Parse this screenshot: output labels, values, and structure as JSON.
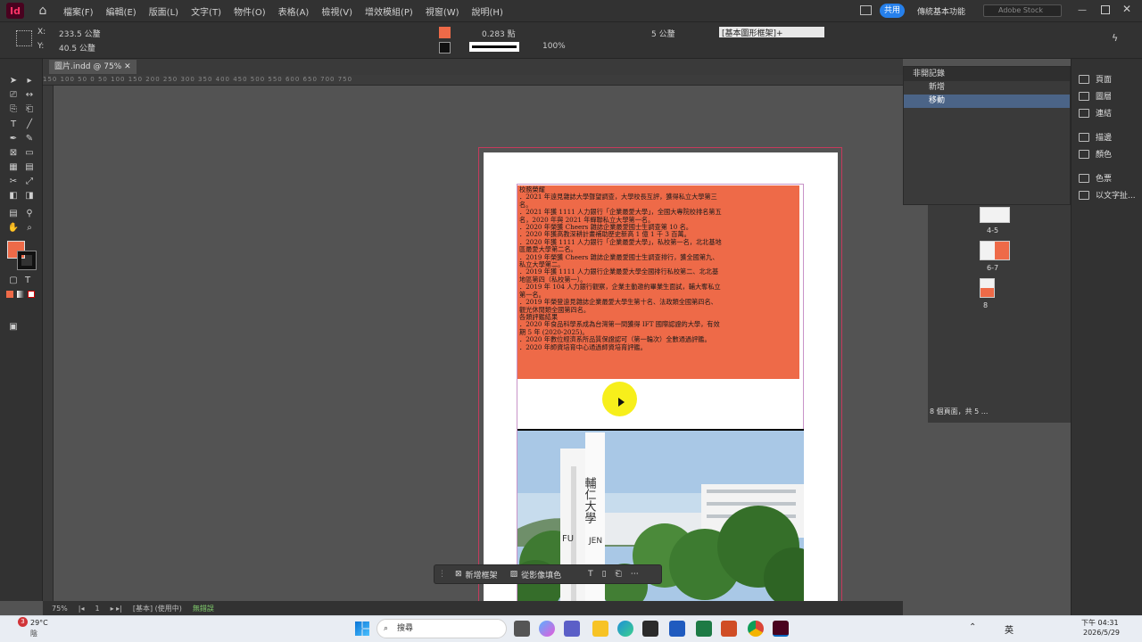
{
  "app": {
    "logo": "Id",
    "share_label": "共用",
    "workspace": "傳統基本功能",
    "search_placeholder": "Adobe Stock"
  },
  "menu": [
    "檔案(F)",
    "編輯(E)",
    "版面(L)",
    "文字(T)",
    "物件(O)",
    "表格(A)",
    "檢視(V)",
    "增效模組(P)",
    "視窗(W)",
    "說明(H)"
  ],
  "control": {
    "x_label": "X:",
    "x_value": "233.5 公釐",
    "y_label": "Y:",
    "y_value": "40.5 公釐",
    "stroke_weight": "0.283 點",
    "percent": "100%",
    "spacing": "5 公釐",
    "frame_style": "[基本圖形框架]+"
  },
  "doc_tab": "圖片.indd @ 75%",
  "ruler_ticks": "150 100 50 0 50 100 150 200 250 300 350 400 450 500 550 600 650 700 750",
  "status": {
    "zoom": "75%",
    "page": "1",
    "style": "[基本] (使用中)",
    "preflight": "無錯誤"
  },
  "document": {
    "lines": [
      "校務榮耀",
      "．2021 年遠見雜誌大學聲望調查，大學校長互評，獲得私立大學第三",
      "名。",
      "．2021 年獲 1111 人力銀行「企業最愛大學」，全國大專院校排名第五",
      "名，2020 年與 2021 年蟬聯私立大學第一名。",
      "．2020 年榮獲 Cheers 雜誌企業最愛國士生調查第 10 名。",
      "．2020 年獲高教深耕計畫補助歷史新高 1 億 1 千 3 百萬。",
      "．2020 年獲 1111 人力銀行「企業最愛大學」，私校第一名，北北基地",
      "區最愛大學第二名。",
      "．2019 年榮獲 Cheers 雜誌企業最愛國士生調查排行，獲全國第九、",
      "私立大學第二。",
      "．2019 年獲 1111 人力銀行企業最愛大學全國排行私校第二、北北基",
      "地區第四（私校第一）。",
      "．2019 年 104 人力銀行觀察，企業主動邀約畢業生面試，輔大奪私立",
      "第一名。",
      "．2019 年榮登遠見雜誌企業最愛大學生第十名、法政類全國第四名、",
      "觀光休閒類全國第四名。",
      "各類評鑑結果",
      "．2020 年食品科學系成為台灣第一間獲得 IFT 國際認證的大學，有效",
      "期 5 年 (2020-2025)。",
      "．2020 年數位經濟系所品質保證認可（第一輪次）全數通過評鑑。",
      "．2020 年師資培育中心通過師資培育評鑑。"
    ],
    "photo_sign_cn": "輔仁大學",
    "photo_sign_left": "FU",
    "photo_sign_right": "JEN"
  },
  "context_bar": {
    "new_frame": "新增框架",
    "replace_image": "從影像填色"
  },
  "layers_panel": {
    "title": "非開記錄",
    "items": [
      "新增",
      "移動"
    ]
  },
  "pages_panel": {
    "spreads": [
      "4-5",
      "6-7",
      "8"
    ],
    "summary": "8 個頁面，共 5 ..."
  },
  "dock": [
    "頁面",
    "圖層",
    "連結",
    "描邊",
    "顏色",
    "色票",
    "以文字扯..."
  ],
  "taskbar": {
    "temp": "29°C",
    "weather": "陰",
    "badge": "3",
    "search": "搜尋",
    "ime": "英",
    "time": "下午 04:31",
    "date": "2026/5/29"
  },
  "colors": {
    "accent": "#ee6a48",
    "highlight": "#f7ef1b",
    "bleed": "#c53a5c"
  }
}
